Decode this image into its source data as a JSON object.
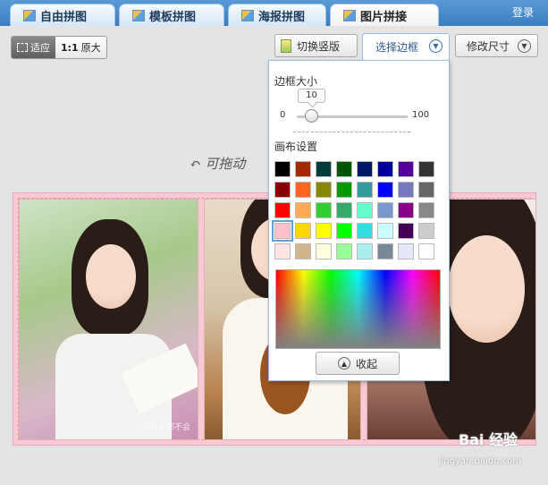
{
  "tabs": [
    {
      "label": "自由拼图"
    },
    {
      "label": "模板拼图"
    },
    {
      "label": "海报拼图"
    },
    {
      "label": "图片拼接"
    }
  ],
  "login_label": "登录",
  "toolbar": {
    "fit_label": "适应",
    "orig_prefix": "1:1",
    "orig_label": "原大",
    "switch_label": "切换竖版",
    "border_label": "选择边框",
    "resize_label": "修改尺寸"
  },
  "canvas": {
    "hint": "↶ 可拖动",
    "photo1_watermark": "©什么都不会"
  },
  "border_popup": {
    "size_title": "边框大小",
    "slider": {
      "min_label": "0",
      "max_label": "100",
      "value": "10"
    },
    "canvas_title": "画布设置",
    "swatches": [
      "#000000",
      "#a32a00",
      "#003b3b",
      "#005500",
      "#001a66",
      "#000099",
      "#550099",
      "#333333",
      "#880000",
      "#ff6622",
      "#888800",
      "#009900",
      "#339999",
      "#0000ff",
      "#7777bb",
      "#666666",
      "#ff0000",
      "#ffaa55",
      "#33cc33",
      "#33aa66",
      "#66ffcc",
      "#7799cc",
      "#880088",
      "#888888",
      "#ffc0cb",
      "#ffd700",
      "#ffff00",
      "#00ff00",
      "#33dddd",
      "#ccffff",
      "#440055",
      "#cccccc",
      "#ffe4e1",
      "#d2b48c",
      "#ffffe0",
      "#99ff99",
      "#aaeeee",
      "#778899",
      "#e6e6fa",
      "#ffffff"
    ],
    "selected_swatch": 24,
    "collapse_label": "收起"
  },
  "watermark": {
    "logo": "Bai 经验",
    "url": "jingyan.baidu.com"
  }
}
